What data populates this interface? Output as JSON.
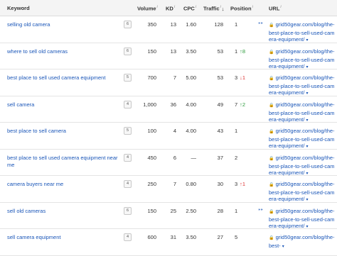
{
  "header": {
    "keyword": "Keyword",
    "volume": "Volume",
    "kd": "KD",
    "cpc": "CPC",
    "traffic": "Traffic",
    "traffic_sort": "↓",
    "position": "Position",
    "url": "URL"
  },
  "icons": {
    "info": "i",
    "lock": "🔒",
    "caret": "▾",
    "organic": "⁍⁍"
  },
  "rows": [
    {
      "keyword": "selling old camera",
      "sf": "6",
      "volume": "350",
      "kd": "13",
      "cpc": "1.60",
      "traffic": "128",
      "position": "1",
      "change": "",
      "change_dir": "",
      "url": "grid50gear.com/blog/the-best-place-to-sell-used-camera-equipment/"
    },
    {
      "keyword": "where to sell old cameras",
      "sf": "6",
      "volume": "150",
      "kd": "13",
      "cpc": "3.50",
      "traffic": "53",
      "position": "1",
      "change": "↑8",
      "change_dir": "up",
      "url": "grid50gear.com/blog/the-best-place-to-sell-used-camera-equipment/"
    },
    {
      "keyword": "best place to sell used camera equipment",
      "sf": "5",
      "volume": "700",
      "kd": "7",
      "cpc": "5.00",
      "traffic": "53",
      "position": "3",
      "change": "↓1",
      "change_dir": "down",
      "url": "grid50gear.com/blog/the-best-place-to-sell-used-camera-equipment/"
    },
    {
      "keyword": "sell camera",
      "sf": "4",
      "volume": "1,000",
      "kd": "36",
      "cpc": "4.00",
      "traffic": "49",
      "position": "7",
      "change": "↑2",
      "change_dir": "up",
      "url": "grid50gear.com/blog/the-best-place-to-sell-used-camera-equipment/"
    },
    {
      "keyword": "best place to sell camera",
      "sf": "5",
      "volume": "100",
      "kd": "4",
      "cpc": "4.00",
      "traffic": "43",
      "position": "1",
      "change": "",
      "change_dir": "",
      "url": "grid50gear.com/blog/the-best-place-to-sell-used-camera-equipment/"
    },
    {
      "keyword": "best place to sell used camera equipment near me",
      "sf": "4",
      "volume": "450",
      "kd": "6",
      "cpc": "—",
      "traffic": "37",
      "position": "2",
      "change": "",
      "change_dir": "",
      "url": "grid50gear.com/blog/the-best-place-to-sell-used-camera-equipment/"
    },
    {
      "keyword": "camera buyers near me",
      "sf": "4",
      "volume": "250",
      "kd": "7",
      "cpc": "0.80",
      "traffic": "30",
      "position": "3",
      "change": "↑1",
      "change_dir": "down",
      "url": "grid50gear.com/blog/the-best-place-to-sell-used-camera-equipment/"
    },
    {
      "keyword": "sell old cameras",
      "sf": "6",
      "volume": "150",
      "kd": "25",
      "cpc": "2.50",
      "traffic": "28",
      "position": "1",
      "change": "",
      "change_dir": "",
      "url": "grid50gear.com/blog/the-best-place-to-sell-used-camera-equipment/"
    },
    {
      "keyword": "sell camera equipment",
      "sf": "4",
      "volume": "600",
      "kd": "31",
      "cpc": "3.50",
      "traffic": "27",
      "position": "5",
      "change": "",
      "change_dir": "",
      "url": "grid50gear.com/blog/the-best-"
    }
  ],
  "organic_rows": [
    0,
    7
  ]
}
